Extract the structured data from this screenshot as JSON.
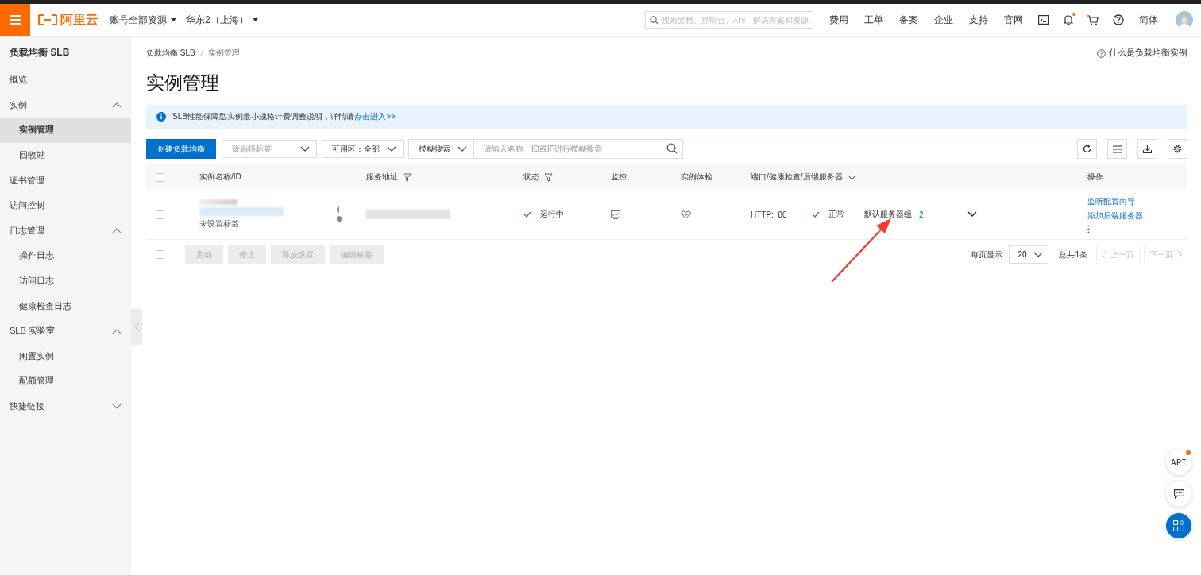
{
  "topbar": {
    "brand": "阿里云",
    "account_menu": "账号全部资源",
    "region_menu": "华东2（上海）",
    "search": {
      "placeholder": "搜索文档、控制台、API、解决方案和资源"
    },
    "links": [
      "费用",
      "工单",
      "备案",
      "企业",
      "支持",
      "官网"
    ],
    "notification_dot": true,
    "language": "简体"
  },
  "sidebar": {
    "title": "负载均衡 SLB",
    "items": [
      {
        "label": "概览",
        "selected": false
      },
      {
        "label": "实例",
        "selected": false,
        "expanded": true,
        "children": [
          {
            "label": "实例管理",
            "selected": true
          },
          {
            "label": "回收站",
            "selected": false
          }
        ]
      },
      {
        "label": "证书管理",
        "selected": false
      },
      {
        "label": "访问控制",
        "selected": false
      },
      {
        "label": "日志管理",
        "selected": false,
        "expanded": true,
        "children": [
          {
            "label": "操作日志",
            "selected": false
          },
          {
            "label": "访问日志",
            "selected": false
          },
          {
            "label": "健康检查日志",
            "selected": false
          }
        ]
      },
      {
        "label": "SLB 实验室",
        "selected": false,
        "expanded": true,
        "children": [
          {
            "label": "闲置实例",
            "selected": false
          },
          {
            "label": "配额管理",
            "selected": false
          }
        ]
      },
      {
        "label": "快捷链接",
        "selected": false,
        "expanded": false
      }
    ]
  },
  "breadcrumb": [
    "负载均衡 SLB",
    "实例管理"
  ],
  "breadcrumb_separator": "/",
  "help_link": "什么是负载均衡实例",
  "page_title": "实例管理",
  "notice": {
    "text": "SLB性能保障型实例最小规格计费调整说明，详情请",
    "link": "点击进入>>"
  },
  "toolbar": {
    "create_button": "创建负载均衡",
    "tag_select": {
      "placeholder": "请选择标签"
    },
    "zone_select": "可用区：全部",
    "search_mode": "模糊搜索",
    "search": {
      "placeholder": "请输入名称、ID或IP进行模糊搜索"
    }
  },
  "table": {
    "header_checked": false,
    "columns": [
      {
        "label": "实例名称/ID",
        "kind": "plain"
      },
      {
        "label": "服务地址",
        "kind": "filter"
      },
      {
        "label": "状态",
        "kind": "filter"
      },
      {
        "label": "监控",
        "kind": "plain"
      },
      {
        "label": "实例体检",
        "kind": "plain"
      },
      {
        "label": "端口/健康检查/后端服务器",
        "kind": "dropdown"
      },
      {
        "label": "操作",
        "kind": "plain"
      }
    ],
    "rows": [
      {
        "checked": false,
        "tag": "未设置标签",
        "status": "运行中",
        "port": "HTTP:  80",
        "health": "正常",
        "server_group": "默认服务器组",
        "server_count": "2",
        "actions": [
          "监听配置向导",
          "添加后端服务器"
        ]
      }
    ]
  },
  "batch_checked": false,
  "batch_buttons": [
    {
      "label": "启动",
      "disabled": true
    },
    {
      "label": "停止",
      "disabled": true
    },
    {
      "label": "释放设置",
      "disabled": true
    },
    {
      "label": "编辑标签",
      "disabled": true
    }
  ],
  "pagination": {
    "page_size_label": "每页显示",
    "page_size": "20",
    "total": "总共1条",
    "prev": {
      "label": "上一页",
      "disabled": true
    },
    "next": {
      "label": "下一页",
      "disabled": true
    }
  },
  "float_buttons": {
    "api_label": "API",
    "api_dot": true
  }
}
